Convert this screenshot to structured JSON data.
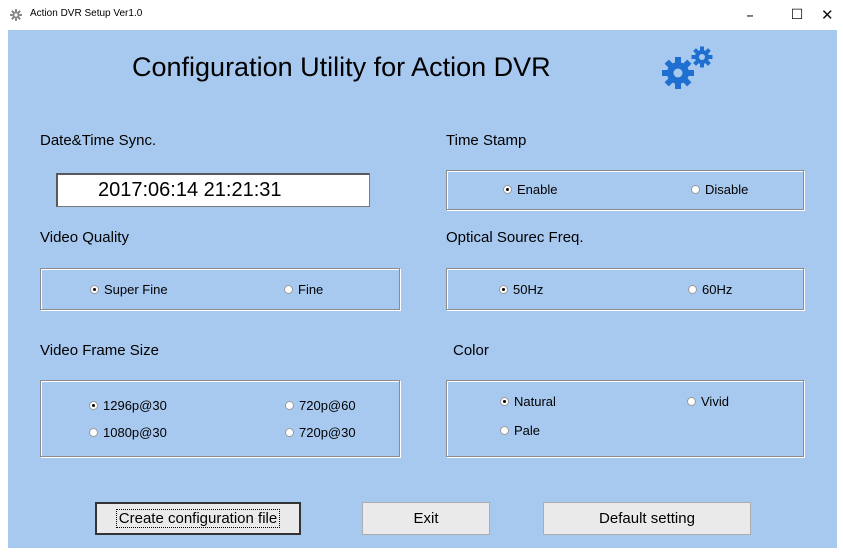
{
  "window": {
    "title": "Action DVR Setup Ver1.0",
    "minimize_glyph": "–",
    "maximize_glyph": "☐",
    "close_glyph": "✕"
  },
  "heading": "Configuration Utility for Action DVR",
  "icons": {
    "app": "gear-icon",
    "header": "gears-icon"
  },
  "colors": {
    "background": "#a8c9ef",
    "gear_blue": "#1e6fd0"
  },
  "datetime": {
    "label": "Date&Time Sync.",
    "value": "2017:06:14  21:21:31"
  },
  "timestamp": {
    "label": "Time Stamp",
    "options": [
      {
        "label": "Enable",
        "selected": true
      },
      {
        "label": "Disable",
        "selected": false
      }
    ]
  },
  "video_quality": {
    "label": "Video Quality",
    "options": [
      {
        "label": "Super Fine",
        "selected": true
      },
      {
        "label": "Fine",
        "selected": false
      }
    ]
  },
  "optical_freq": {
    "label": "Optical Sourec Freq.",
    "options": [
      {
        "label": "50Hz",
        "selected": true
      },
      {
        "label": "60Hz",
        "selected": false
      }
    ]
  },
  "frame_size": {
    "label": "Video Frame Size",
    "options": [
      {
        "label": "1296p@30",
        "selected": true
      },
      {
        "label": "720p@60",
        "selected": false
      },
      {
        "label": "1080p@30",
        "selected": false
      },
      {
        "label": "720p@30",
        "selected": false
      }
    ]
  },
  "color": {
    "label": "Color",
    "options": [
      {
        "label": "Natural",
        "selected": true
      },
      {
        "label": "Vivid",
        "selected": false
      },
      {
        "label": "Pale",
        "selected": false
      }
    ]
  },
  "buttons": {
    "create": "Create configuration file",
    "exit": "Exit",
    "default": "Default setting"
  }
}
